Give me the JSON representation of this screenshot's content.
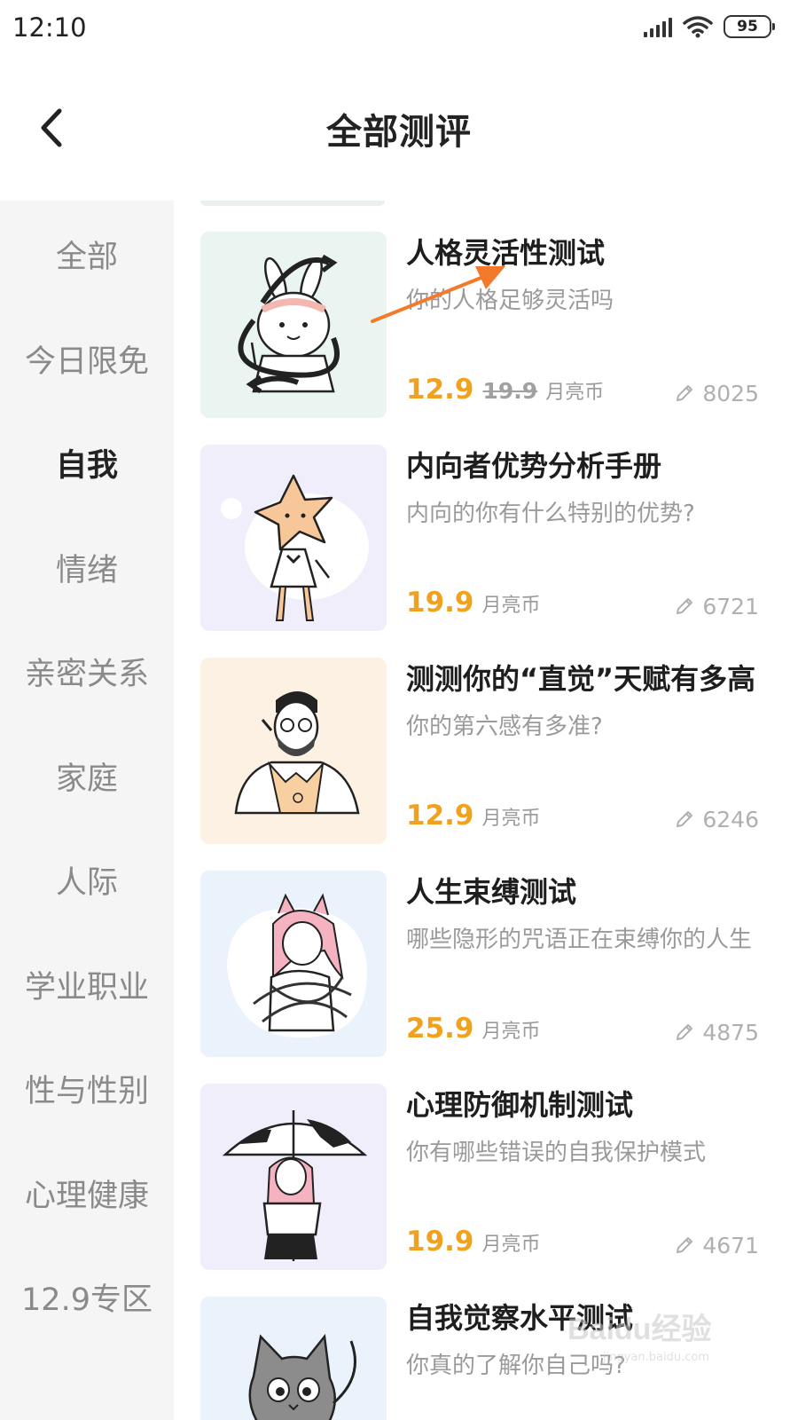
{
  "status": {
    "time": "12:10",
    "battery": "95"
  },
  "header": {
    "title": "全部测评"
  },
  "sidebar": {
    "items": [
      {
        "label": "全部"
      },
      {
        "label": "今日限免"
      },
      {
        "label": "自我",
        "active": true
      },
      {
        "label": "情绪"
      },
      {
        "label": "亲密关系"
      },
      {
        "label": "家庭"
      },
      {
        "label": "人际"
      },
      {
        "label": "学业职业"
      },
      {
        "label": "性与性别"
      },
      {
        "label": "心理健康"
      },
      {
        "label": "12.9专区"
      }
    ]
  },
  "cards": [
    {
      "title": "人格灵活性测试",
      "subtitle": "你的人格足够灵活吗",
      "price": "12.9",
      "old_price": "19.9",
      "unit": "月亮币",
      "count": "8025",
      "bg": "#eaf4f0",
      "icon": "rabbit-illustration"
    },
    {
      "title": "内向者优势分析手册",
      "subtitle": "内向的你有什么特别的优势?",
      "price": "19.9",
      "old_price": "",
      "unit": "月亮币",
      "count": "6721",
      "bg": "#efeefa",
      "icon": "star-girl-illustration"
    },
    {
      "title": "测测你的“直觉”天赋有多高",
      "subtitle": "你的第六感有多准?",
      "price": "12.9",
      "old_price": "",
      "unit": "月亮币",
      "count": "6246",
      "bg": "#fdf1e3",
      "icon": "bearded-man-illustration"
    },
    {
      "title": "人生束缚测试",
      "subtitle": "哪些隐形的咒语正在束缚你的人生",
      "price": "25.9",
      "old_price": "",
      "unit": "月亮币",
      "count": "4875",
      "bg": "#eaf3fc",
      "icon": "bound-cat-girl-illustration"
    },
    {
      "title": "心理防御机制测试",
      "subtitle": "你有哪些错误的自我保护模式",
      "price": "19.9",
      "old_price": "",
      "unit": "月亮币",
      "count": "4671",
      "bg": "#efeefa",
      "icon": "umbrella-girl-illustration"
    },
    {
      "title": "自我觉察水平测试",
      "subtitle": "你真的了解你自己吗?",
      "price": "",
      "old_price": "",
      "unit": "",
      "count": "",
      "bg": "#eaf3fc",
      "icon": "cat-illustration"
    }
  ],
  "watermark": {
    "text": "Baidu经验",
    "url": "jingyan.baidu.com"
  },
  "colors": {
    "price": "#f0a21f",
    "annotation_arrow": "#f47a2b",
    "sidebar_bg": "#f5f5f5"
  }
}
